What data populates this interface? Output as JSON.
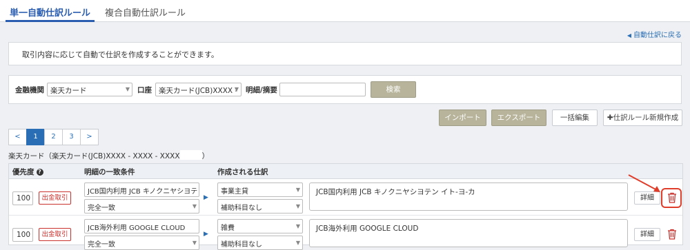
{
  "tabs": {
    "active": "単一自動仕訳ルール",
    "inactive": "複合自動仕訳ルール"
  },
  "back_link": "自動仕訳に戻る",
  "info": "取引内容に応じて自動で仕訳を作成することができます。",
  "search": {
    "institution_label": "金融機関",
    "institution_value": "楽天カード",
    "account_label": "口座",
    "account_value": "楽天カード(JCB)XXXX -",
    "detail_label": "明細/摘要",
    "detail_value": "",
    "search_button": "検索"
  },
  "actions": {
    "import": "インポート",
    "export": "エクスポート",
    "bulk_edit": "一括編集",
    "new_rule": "✚仕訳ルール新規作成"
  },
  "pager": [
    "<",
    "1",
    "2",
    "3",
    ">"
  ],
  "account_title": "楽天カード（楽天カード(JCB)XXXX - XXXX - XXXX",
  "account_title_end": "）",
  "table": {
    "headers": {
      "priority": "優先度",
      "condition": "明細の一致条件",
      "entry": "作成される仕訳"
    },
    "rows": [
      {
        "priority": "100",
        "badge": "出金取引",
        "condition_text": "JCB国内利用 JCB キノクニヤシヨテ",
        "match_type": "完全一致",
        "account": "事業主貸",
        "sub_account": "補助科目なし",
        "memo": "JCB国内利用 JCB キノクニヤシヨテン イト-ヨ-カ",
        "detail_button": "詳細"
      },
      {
        "priority": "100",
        "badge": "出金取引",
        "condition_text": "JCB海外利用 GOOGLE CLOUD",
        "match_type": "完全一致",
        "account": "雑費",
        "sub_account": "補助科目なし",
        "memo": "JCB海外利用 GOOGLE CLOUD",
        "detail_button": "詳細"
      }
    ]
  },
  "colors": {
    "accent": "#2a5db0",
    "annotation": "#e03c2a",
    "delete": "#c9302c"
  }
}
